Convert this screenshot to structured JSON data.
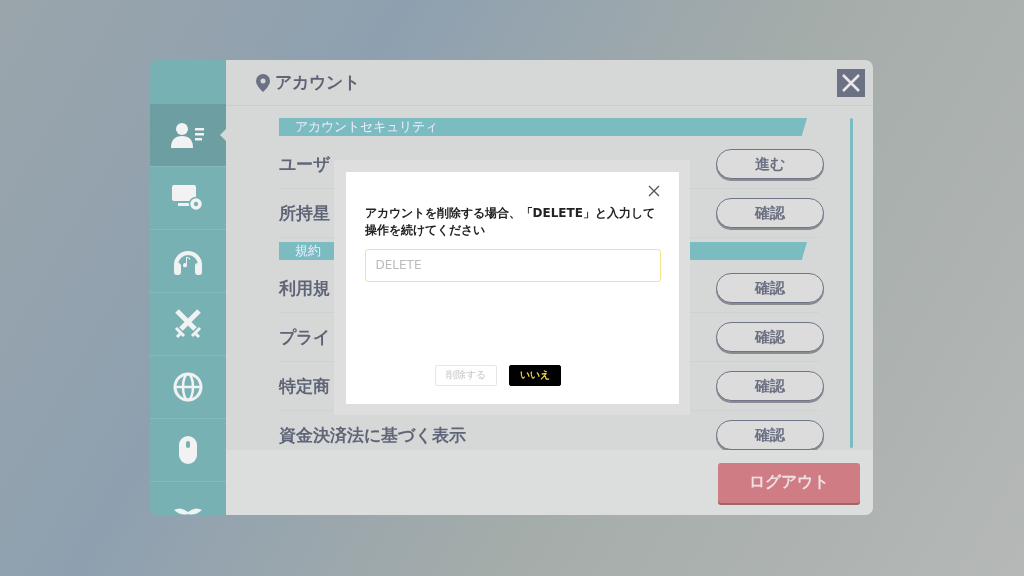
{
  "panel": {
    "title": "アカウント",
    "sidebar": {
      "items": [
        {
          "selected": true
        },
        {
          "selected": false
        },
        {
          "selected": false
        },
        {
          "selected": false
        },
        {
          "selected": false
        },
        {
          "selected": false
        },
        {
          "selected": false
        }
      ]
    },
    "sections": [
      {
        "title": "アカウントセキュリティ",
        "rows": [
          {
            "label": "ユーザ",
            "button": "進む"
          },
          {
            "label": "所持星",
            "button": "確認"
          }
        ]
      },
      {
        "title": "規約",
        "rows": [
          {
            "label": "利用規",
            "button": "確認"
          },
          {
            "label": "プライ",
            "button": "確認"
          },
          {
            "label": "特定商",
            "button": "確認"
          },
          {
            "label": "資金決済法に基づく表示",
            "button": "確認"
          }
        ]
      }
    ],
    "logout_button": "ログアウト"
  },
  "dialog": {
    "message": "アカウントを削除する場合、「DELETE」と入力して操作を続けてください",
    "input": {
      "placeholder": "DELETE"
    },
    "buttons": [
      {
        "label": "削除する",
        "disabled": true,
        "kind": "secondary"
      },
      {
        "label": "いいえ",
        "disabled": false,
        "kind": "primary"
      }
    ]
  }
}
